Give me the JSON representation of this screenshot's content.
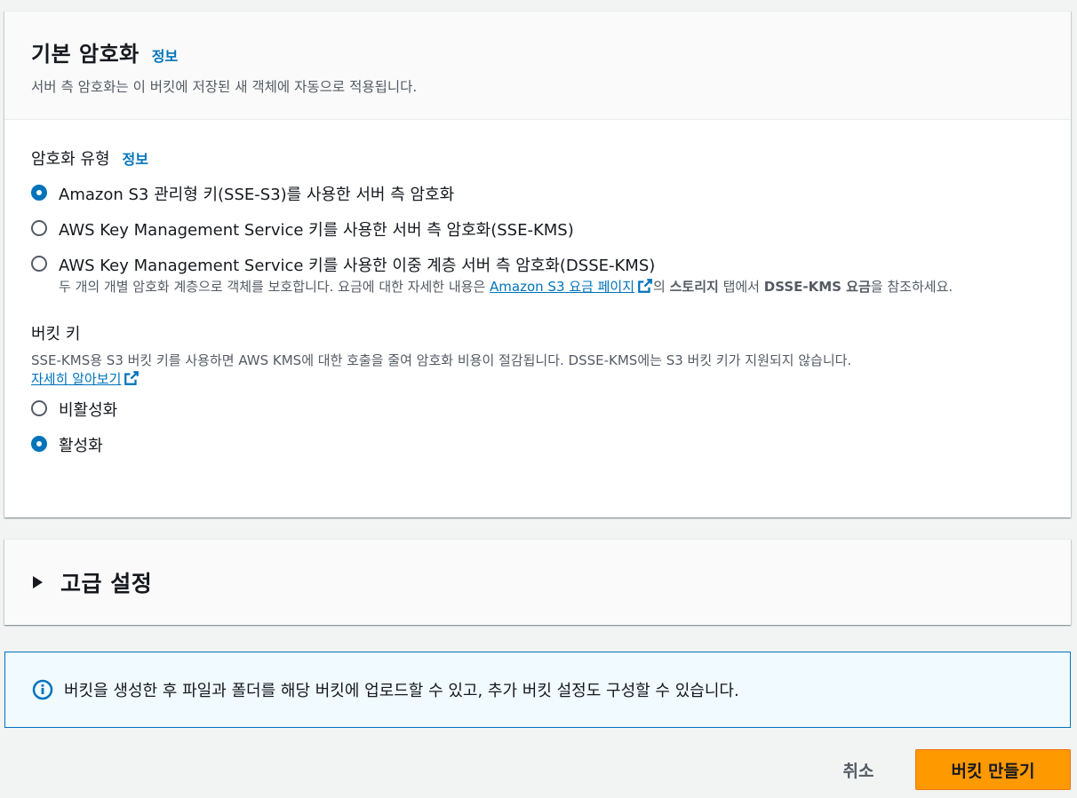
{
  "encryption": {
    "title": "기본 암호화",
    "info": "정보",
    "subtitle": "서버 측 암호화는 이 버킷에 저장된 새 객체에 자동으로 적용됩니다.",
    "type_label": "암호화 유형",
    "type_info": "정보",
    "options": [
      {
        "label": "Amazon S3 관리형 키(SSE-S3)를 사용한 서버 측 암호화",
        "checked": true
      },
      {
        "label": "AWS Key Management Service 키를 사용한 서버 측 암호화(SSE-KMS)",
        "checked": false
      },
      {
        "label": "AWS Key Management Service 키를 사용한 이중 계층 서버 측 암호화(DSSE-KMS)",
        "checked": false,
        "desc_before": "두 개의 개별 암호화 계층으로 객체를 보호합니다. 요금에 대한 자세한 내용은 ",
        "desc_link": "Amazon S3 요금 페이지",
        "desc_mid1": "의 ",
        "desc_bold1": "스토리지",
        "desc_mid2": " 탭에서 ",
        "desc_bold2": "DSSE-KMS 요금",
        "desc_after": "을 참조하세요."
      }
    ]
  },
  "bucket_key": {
    "label": "버킷 키",
    "desc": "SSE-KMS용 S3 버킷 키를 사용하면 AWS KMS에 대한 호출을 줄여 암호화 비용이 절감됩니다. DSSE-KMS에는 S3 버킷 키가 지원되지 않습니다.",
    "learn_more": "자세히 알아보기",
    "options": [
      {
        "label": "비활성화",
        "checked": false
      },
      {
        "label": "활성화",
        "checked": true
      }
    ]
  },
  "advanced": {
    "title": "고급 설정"
  },
  "alert": {
    "text": "버킷을 생성한 후 파일과 폴더를 해당 버킷에 업로드할 수 있고, 추가 버킷 설정도 구성할 수 있습니다."
  },
  "actions": {
    "cancel": "취소",
    "create": "버킷 만들기"
  },
  "colors": {
    "accent": "#0073bb",
    "primary_button": "#ff9900",
    "alert_bg": "#f1faff"
  }
}
